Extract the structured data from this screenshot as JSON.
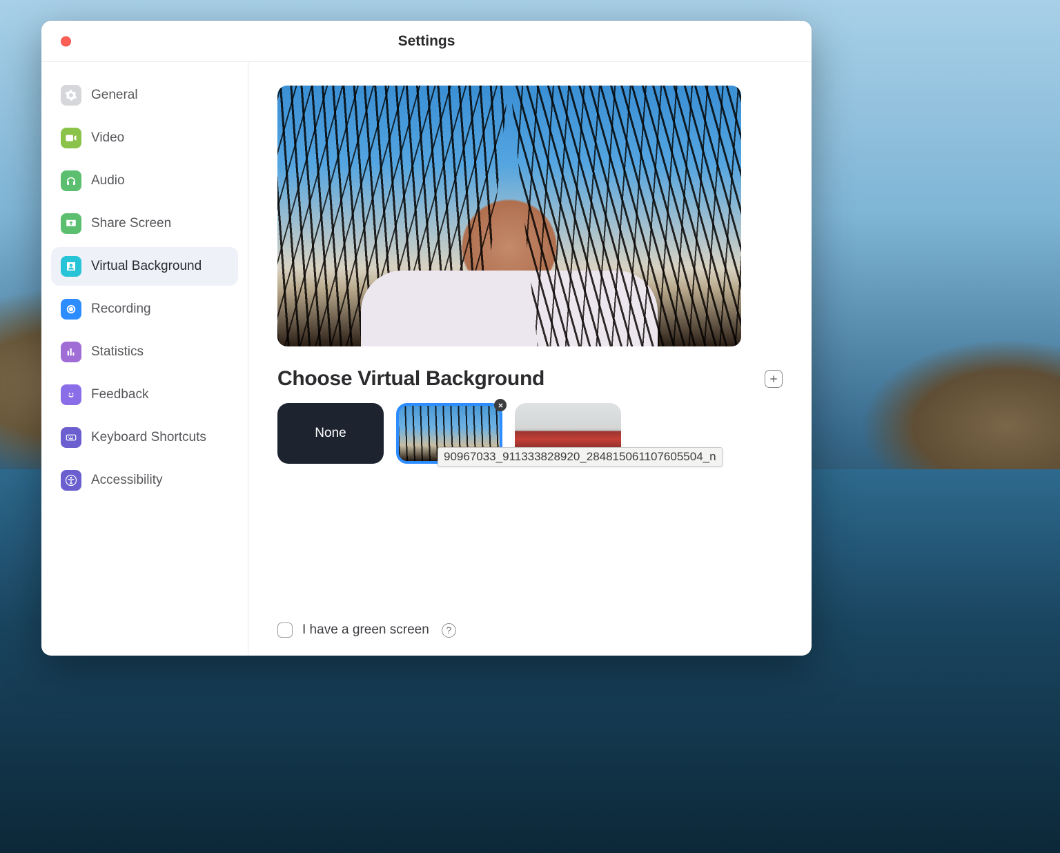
{
  "window": {
    "title": "Settings"
  },
  "sidebar": {
    "items": [
      {
        "label": "General",
        "icon_color": "#d6d7db",
        "active": false
      },
      {
        "label": "Video",
        "icon_color": "#8bc34a",
        "active": false
      },
      {
        "label": "Audio",
        "icon_color": "#5bbf6f",
        "active": false
      },
      {
        "label": "Share Screen",
        "icon_color": "#5bbf6f",
        "active": false
      },
      {
        "label": "Virtual Background",
        "icon_color": "#27c3d6",
        "active": true
      },
      {
        "label": "Recording",
        "icon_color": "#2d8cff",
        "active": false
      },
      {
        "label": "Statistics",
        "icon_color": "#a06cd5",
        "active": false
      },
      {
        "label": "Feedback",
        "icon_color": "#8a6ee8",
        "active": false
      },
      {
        "label": "Keyboard Shortcuts",
        "icon_color": "#6b5ecf",
        "active": false
      },
      {
        "label": "Accessibility",
        "icon_color": "#6b5ecf",
        "active": false
      }
    ]
  },
  "content": {
    "section_title": "Choose Virtual Background",
    "thumbs": {
      "none_label": "None",
      "selected_tooltip": "90967033_911333828920_284815061107605504_n"
    },
    "green_screen_label": "I have a green screen",
    "green_screen_checked": false
  }
}
